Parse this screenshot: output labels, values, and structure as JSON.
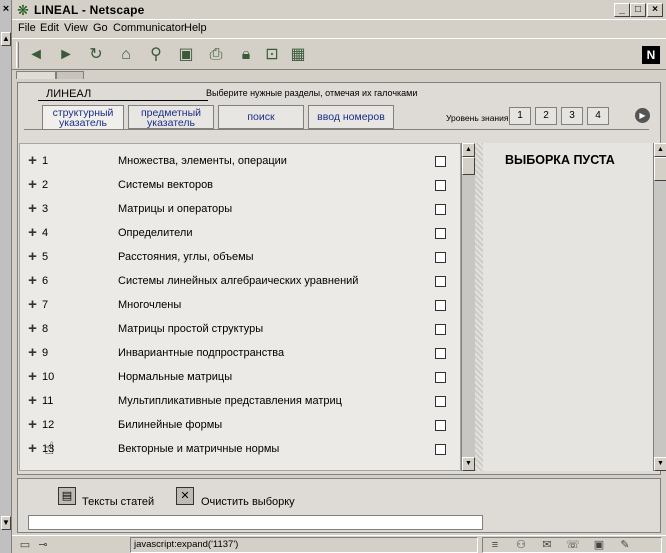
{
  "window": {
    "title": "LINEAL - Netscape"
  },
  "menu": [
    "File",
    "Edit",
    "View",
    "Go",
    "Communicator",
    "Help"
  ],
  "page": {
    "brand": "ЛИНЕАЛ",
    "instruction": "Выберите нужные разделы, отмечая их галочками",
    "tabs": [
      {
        "line1": "структурный",
        "line2": "указатель"
      },
      {
        "line1": "предметный",
        "line2": "указатель"
      },
      {
        "label": "поиск"
      },
      {
        "label": "ввод номеров"
      }
    ],
    "knowledge_level": {
      "label": "Уровень знания",
      "levels": [
        "1",
        "2",
        "3",
        "4"
      ]
    },
    "topics": [
      {
        "num": "1",
        "label": "Множества, элементы, операции"
      },
      {
        "num": "2",
        "label": "Системы векторов"
      },
      {
        "num": "3",
        "label": "Матрицы и операторы"
      },
      {
        "num": "4",
        "label": "Определители"
      },
      {
        "num": "5",
        "label": "Расстояния, углы, объемы"
      },
      {
        "num": "6",
        "label": "Системы линейных алгебраических уравнений"
      },
      {
        "num": "7",
        "label": "Многочлены"
      },
      {
        "num": "8",
        "label": "Матрицы простой структуры"
      },
      {
        "num": "9",
        "label": "Инвариантные подпространства"
      },
      {
        "num": "10",
        "label": "Нормальные матрицы"
      },
      {
        "num": "11",
        "label": "Мультипликативные представления матриц"
      },
      {
        "num": "12",
        "label": "Билинейные формы"
      },
      {
        "num": "13",
        "label": "Векторные и матричные нормы"
      }
    ],
    "selection": {
      "title": "ВЫБОРКА ПУСТА"
    },
    "bottom": {
      "texts_label": "Тексты статей",
      "clear_label": "Очистить выборку"
    }
  },
  "status": {
    "text": "javascript:expand('1137')"
  }
}
